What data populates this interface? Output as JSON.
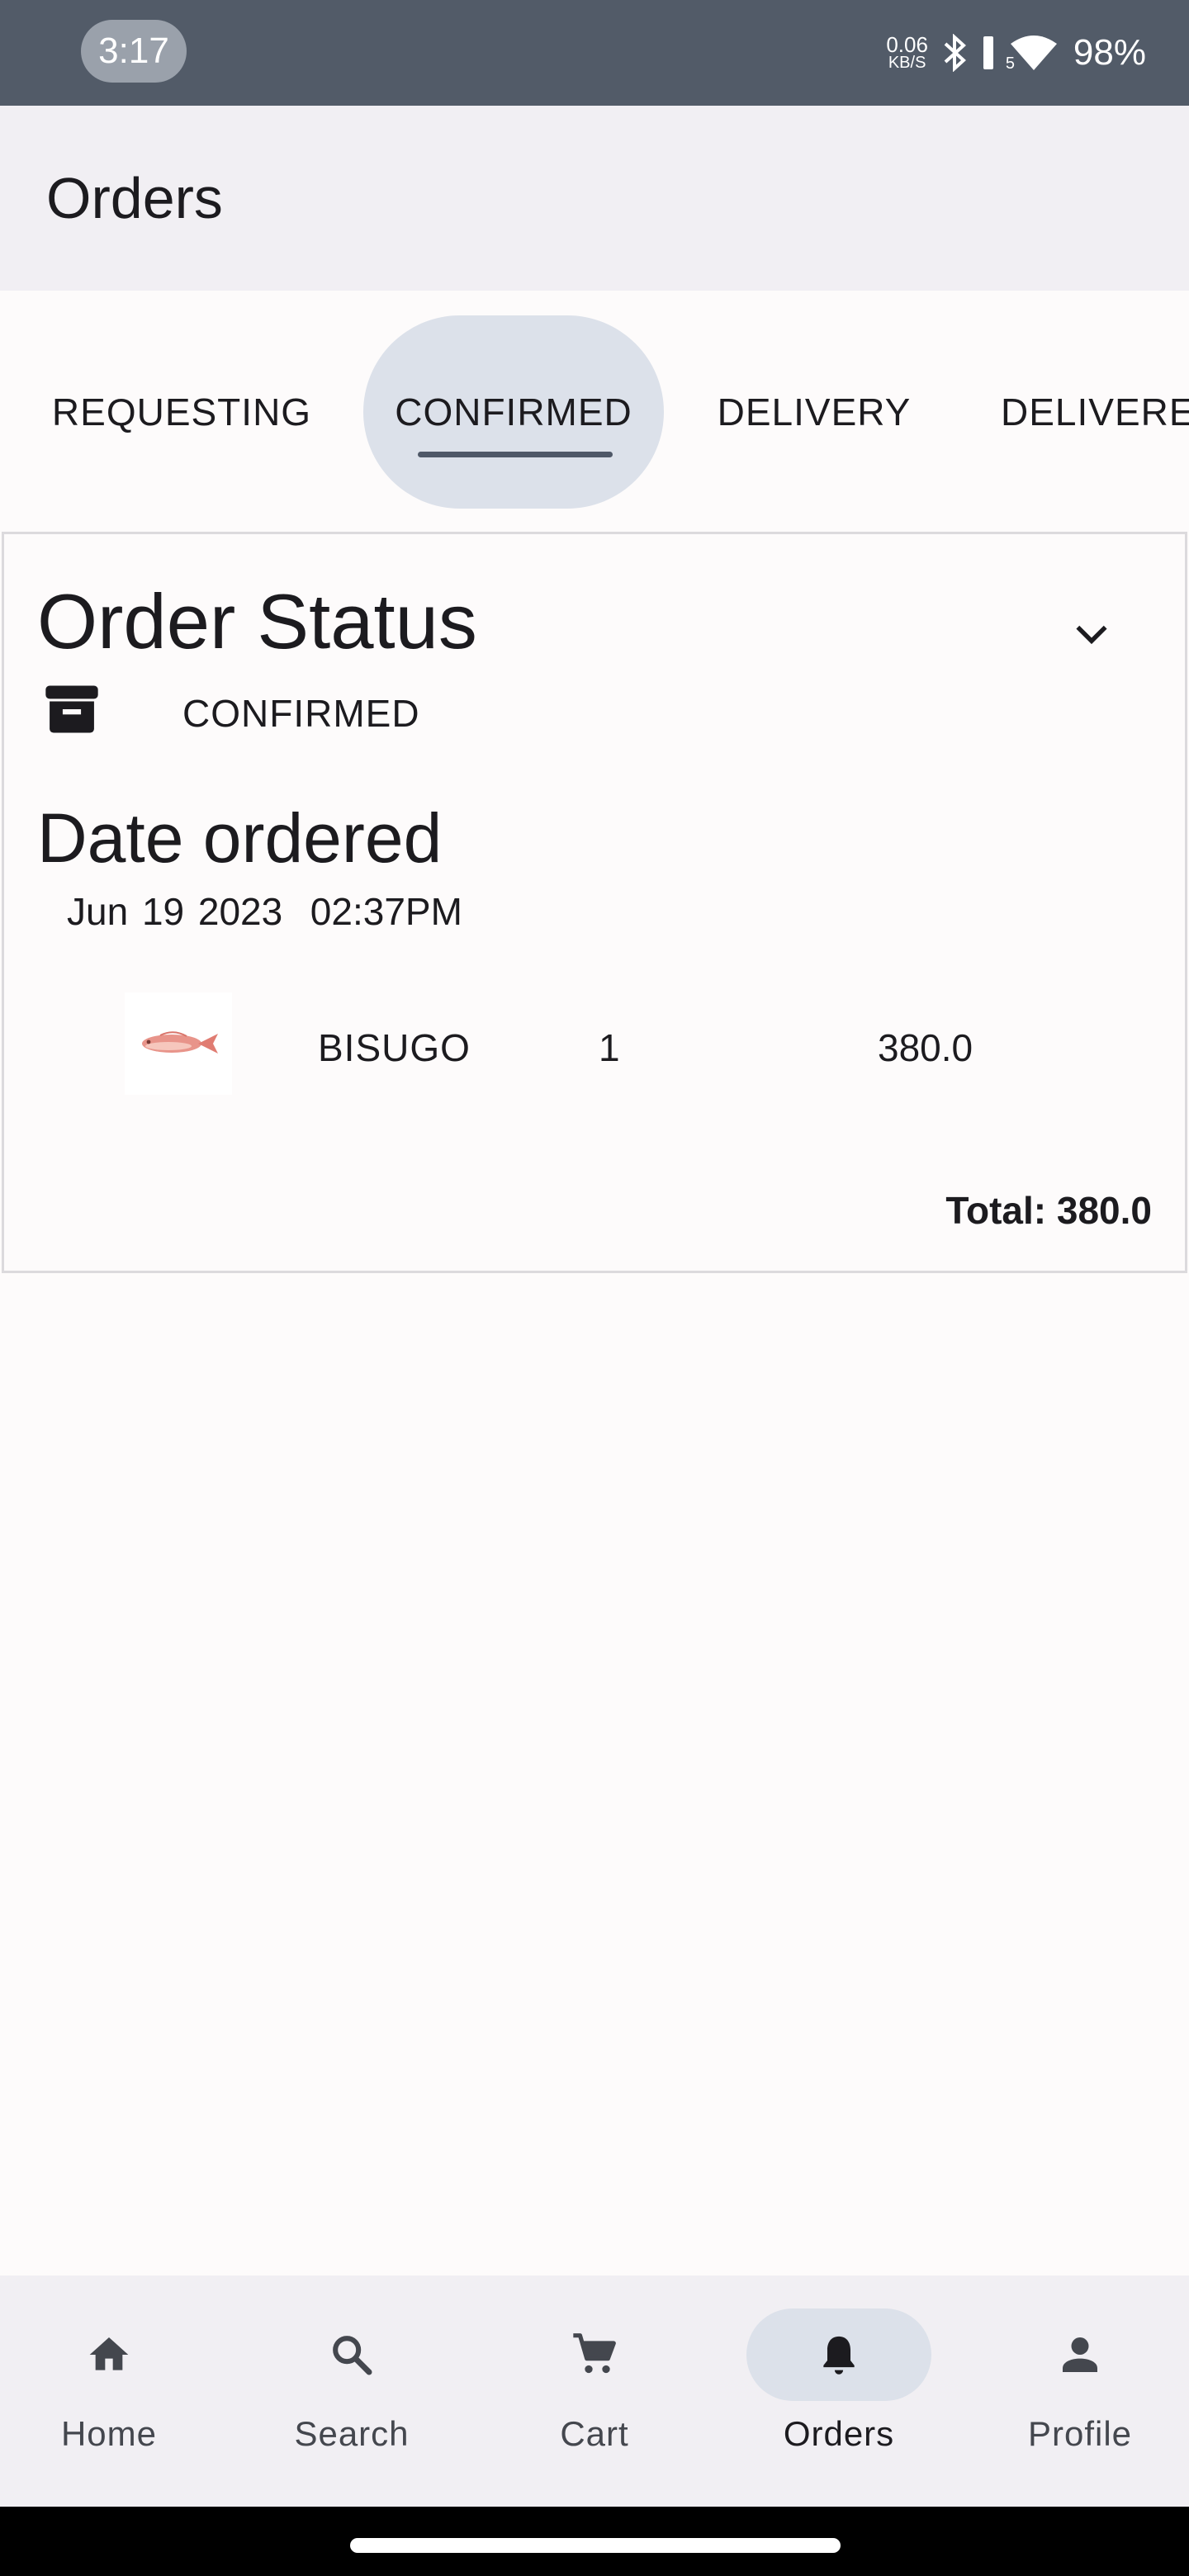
{
  "status_bar": {
    "time": "3:17",
    "net_speed_value": "0.06",
    "net_speed_unit": "KB/S",
    "signal_label": "5",
    "battery": "98%"
  },
  "app_bar": {
    "title": "Orders"
  },
  "tabs": [
    {
      "label": "REQUESTING",
      "active": false
    },
    {
      "label": "CONFIRMED",
      "active": true
    },
    {
      "label": "DELIVERY",
      "active": false
    },
    {
      "label": "DELIVERED",
      "active": false
    }
  ],
  "order": {
    "status_title": "Order Status",
    "status_value": "CONFIRMED",
    "date_label": "Date ordered",
    "date_value": "Jun 19 2023  02:37PM",
    "items": [
      {
        "name": "BISUGO",
        "quantity": "1",
        "price": "380.0"
      }
    ],
    "total": "Total: 380.0"
  },
  "bottom_nav": [
    {
      "label": "Home",
      "icon": "home-icon",
      "active": false
    },
    {
      "label": "Search",
      "icon": "search-icon",
      "active": false
    },
    {
      "label": "Cart",
      "icon": "cart-icon",
      "active": false
    },
    {
      "label": "Orders",
      "icon": "bell-icon",
      "active": true
    },
    {
      "label": "Profile",
      "icon": "person-icon",
      "active": false
    }
  ],
  "colors": {
    "status_bar": "#525b68",
    "surface": "#f1eff3",
    "background": "#fdfbfb",
    "active_indicator": "#dce1ea",
    "tab_underline": "#4f5868"
  }
}
